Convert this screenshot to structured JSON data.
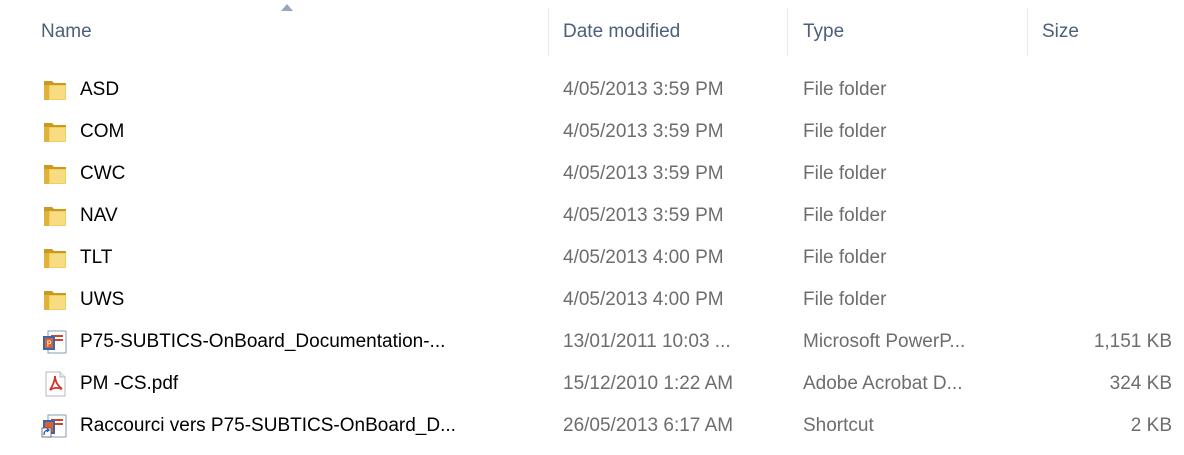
{
  "columns": {
    "name": "Name",
    "date": "Date modified",
    "type": "Type",
    "size": "Size"
  },
  "sort": {
    "column": "name",
    "direction": "ascending"
  },
  "colors": {
    "header_text": "#4c607a",
    "name_text": "#000000",
    "detail_text": "#6d6d6d",
    "folder": "#e8c04a",
    "pdf_red": "#d6322a",
    "ppt_red": "#c9462a"
  },
  "files": [
    {
      "name": "ASD",
      "date": "4/05/2013 3:59 PM",
      "type": "File folder",
      "size": "",
      "icon": "folder-icon"
    },
    {
      "name": "COM",
      "date": "4/05/2013 3:59 PM",
      "type": "File folder",
      "size": "",
      "icon": "folder-icon"
    },
    {
      "name": "CWC",
      "date": "4/05/2013 3:59 PM",
      "type": "File folder",
      "size": "",
      "icon": "folder-icon"
    },
    {
      "name": "NAV",
      "date": "4/05/2013 3:59 PM",
      "type": "File folder",
      "size": "",
      "icon": "folder-icon"
    },
    {
      "name": "TLT",
      "date": "4/05/2013 4:00 PM",
      "type": "File folder",
      "size": "",
      "icon": "folder-icon"
    },
    {
      "name": "UWS",
      "date": "4/05/2013 4:00 PM",
      "type": "File folder",
      "size": "",
      "icon": "folder-icon"
    },
    {
      "name": "P75-SUBTICS-OnBoard_Documentation-...",
      "date": "13/01/2011 10:03 ...",
      "type": "Microsoft PowerP...",
      "size": "1,151 KB",
      "icon": "powerpoint-icon"
    },
    {
      "name": "PM -CS.pdf",
      "date": "15/12/2010 1:22 AM",
      "type": "Adobe Acrobat D...",
      "size": "324 KB",
      "icon": "pdf-icon"
    },
    {
      "name": "Raccourci vers P75-SUBTICS-OnBoard_D...",
      "date": "26/05/2013 6:17 AM",
      "type": "Shortcut",
      "size": "2 KB",
      "icon": "shortcut-icon"
    }
  ]
}
